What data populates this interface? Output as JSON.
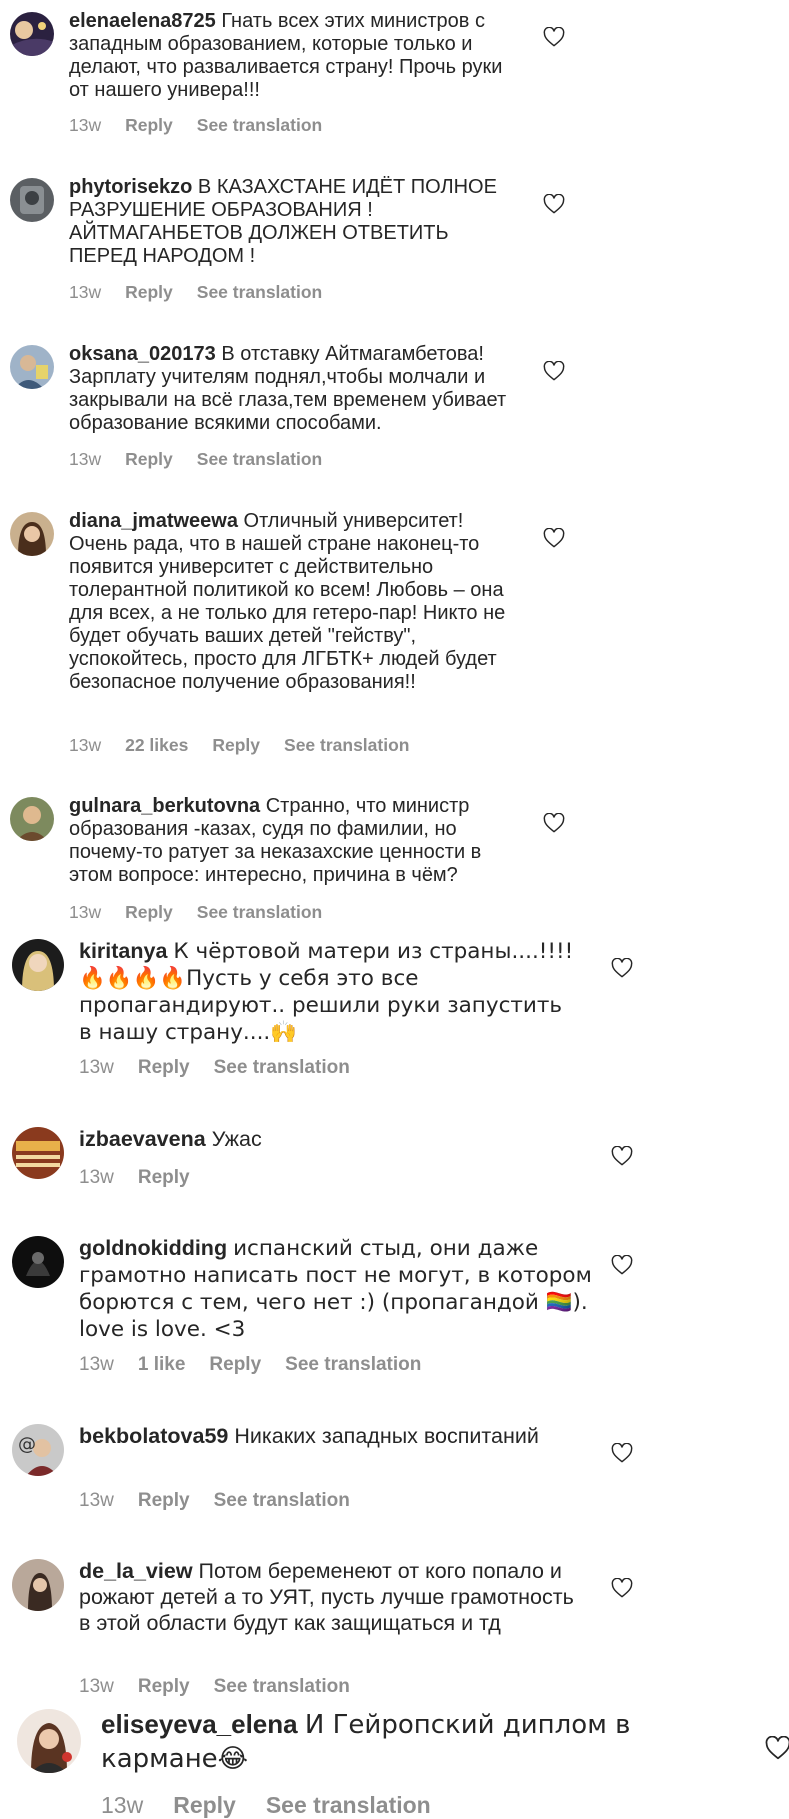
{
  "labels": {
    "reply": "Reply",
    "see_translation": "See translation"
  },
  "colors": {
    "text": "#262626",
    "meta": "#8e8e8e",
    "background": "#ffffff"
  },
  "comments": [
    {
      "username": "elenaelena8725",
      "text": "Гнать всех этих министров с западным образованием, которые только и делают, что разваливается страну! Прочь руки от нашего универа!!!",
      "time": "13w",
      "likes": ""
    },
    {
      "username": "phytorisekzo",
      "text": "В КАЗАХСТАНЕ  ИДЁТ ПОЛНОЕ РАЗРУШЕНИЕ  ОБРАЗОВАНИЯ ! АЙТМАГАНБЕТОВ  ДОЛЖЕН  ОТВЕТИТЬ ПЕРЕД  НАРОДОМ !",
      "time": "13w",
      "likes": ""
    },
    {
      "username": "oksana_020173",
      "text": "В отставку Айтмагамбетова! Зарплату учителям поднял,чтобы молчали и закрывали на всё глаза,тем временем убивает образование всякими способами.",
      "time": "13w",
      "likes": ""
    },
    {
      "username": "diana_jmatweewa",
      "text": "Отличный университет! Очень рада, что в нашей стране наконец-то появится университет с действительно толерантной политикой ко всем! Любовь – она для всех, а не только для гетеро-пар! Никто не будет обучать ваших детей \"гейству\", успокойтесь, просто для ЛГБТК+ людей будет безопасное получение образования!!",
      "time": "13w",
      "likes": "22 likes"
    },
    {
      "username": "gulnara_berkutovna",
      "text": "Странно, что министр образования -казах, судя по фамилии, но почему-то ратует за неказахские ценности в этом вопросе: интересно, причина в чём?",
      "time": "13w",
      "likes": ""
    },
    {
      "username": "kiritanya",
      "text": "К чёртовой матери из страны....!!!! 🔥🔥🔥🔥Пусть у себя это все пропагандируют.. решили руки запустить в нашу страну....🙌",
      "time": "13w",
      "likes": ""
    },
    {
      "username": "izbaevavena",
      "text": "Ужас",
      "time": "13w",
      "likes": ""
    },
    {
      "username": "goldnokidding",
      "text": "испанский стыд, они даже грамотно написать пост не могут, в котором борются с тем, чего нет :) (пропагандой 🏳️‍🌈). love is love. <3",
      "time": "13w",
      "likes": "1 like"
    },
    {
      "username": "bekbolatova59",
      "text": "Никаких западных воспитаний",
      "time": "13w",
      "likes": ""
    },
    {
      "username": "de_la_view",
      "text": "Потом беременеют от кого попало и рожают детей а то УЯТ, пусть лучше грамотность в этой области будут как защищаться и тд",
      "time": "13w",
      "likes": ""
    },
    {
      "username": "eliseyeva_elena",
      "text": "И Гейропский диплом в кармане😂",
      "time": "13w",
      "likes": ""
    }
  ]
}
